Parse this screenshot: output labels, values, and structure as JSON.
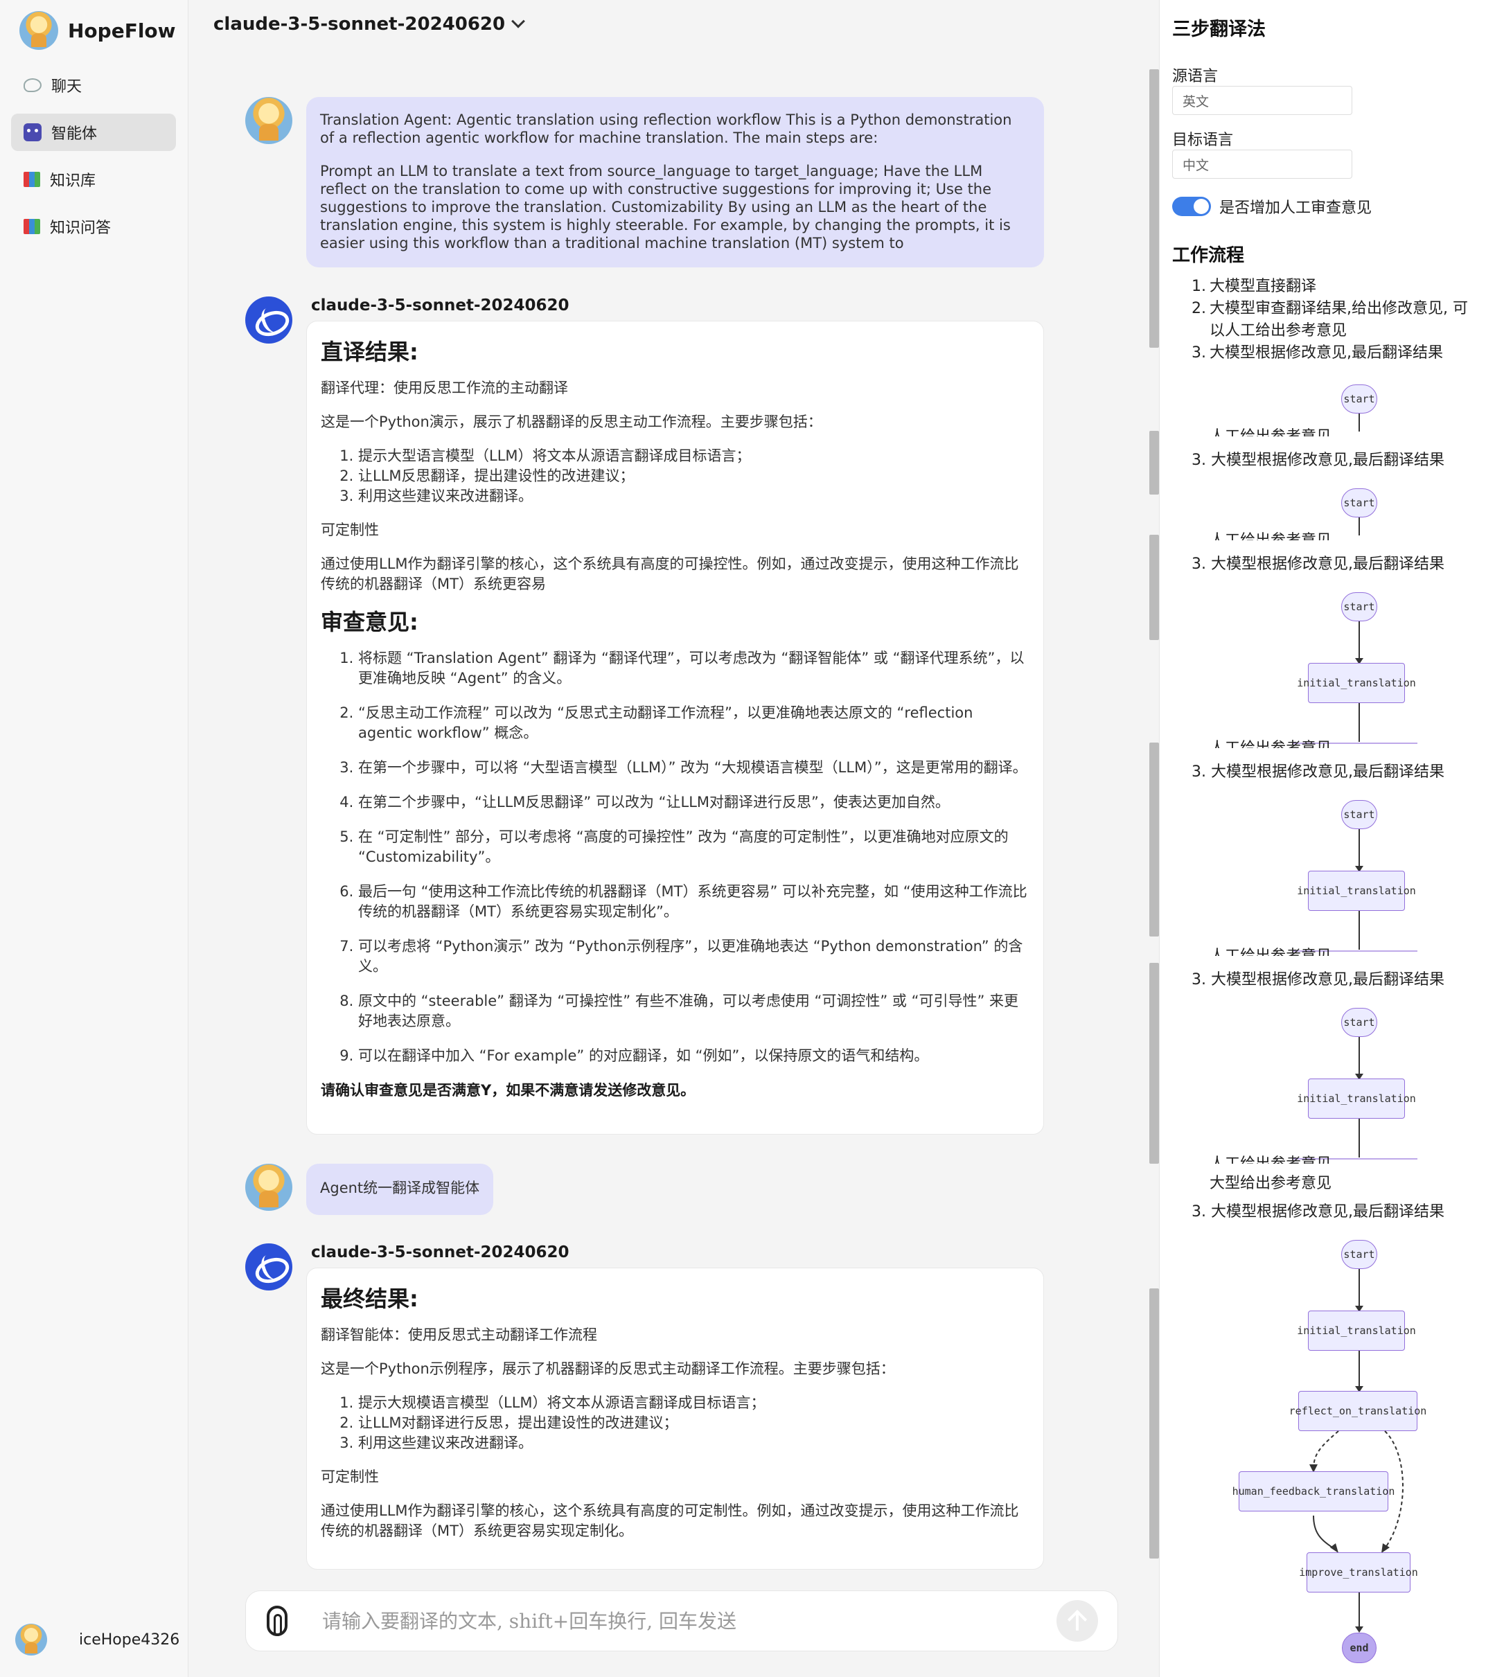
{
  "sidebar": {
    "brand": "HopeFlow",
    "items": [
      {
        "label": "聊天",
        "icon": "chat-bubble-icon"
      },
      {
        "label": "智能体",
        "icon": "robot-icon",
        "active": true
      },
      {
        "label": "知识库",
        "icon": "books-icon"
      },
      {
        "label": "知识问答",
        "icon": "books-icon"
      }
    ],
    "user": "iceHope4326"
  },
  "header": {
    "model": "claude-3-5-sonnet-20240620"
  },
  "messages": {
    "user1": {
      "p1": "Translation Agent: Agentic translation using reflection workflow This is a Python demonstration of a reflection agentic workflow for machine translation. The main steps are:",
      "p2": "Prompt an LLM to translate a text from source_language to target_language; Have the LLM reflect on the translation to come up with constructive suggestions for improving it; Use the suggestions to improve the translation. Customizability By using an LLM as the heart of the translation engine, this system is highly steerable. For example, by changing the prompts, it is easier using this workflow than a traditional machine translation (MT) system to"
    },
    "bot1": {
      "name": "claude-3-5-sonnet-20240620",
      "h1": "直译结果:",
      "p1": "翻译代理：使用反思工作流的主动翻译",
      "p2": "这是一个Python演示，展示了机器翻译的反思主动工作流程。主要步骤包括：",
      "steps": [
        "提示大型语言模型（LLM）将文本从源语言翻译成目标语言；",
        "让LLM反思翻译，提出建设性的改进建议；",
        "利用这些建议来改进翻译。"
      ],
      "p3": "可定制性",
      "p4": "通过使用LLM作为翻译引擎的核心，这个系统具有高度的可操控性。例如，通过改变提示，使用这种工作流比传统的机器翻译（MT）系统更容易",
      "h2": "审查意见:",
      "reviews": [
        "将标题 “Translation Agent” 翻译为 “翻译代理”，可以考虑改为 “翻译智能体” 或 “翻译代理系统”，以更准确地反映 “Agent” 的含义。",
        "“反思主动工作流程” 可以改为 “反思式主动翻译工作流程”，以更准确地表达原文的 “reflection agentic workflow” 概念。",
        "在第一个步骤中，可以将 “大型语言模型（LLM）” 改为 “大规模语言模型（LLM）”，这是更常用的翻译。",
        "在第二个步骤中，“让LLM反思翻译” 可以改为 “让LLM对翻译进行反思”，使表达更加自然。",
        "在 “可定制性” 部分，可以考虑将 “高度的可操控性” 改为 “高度的可定制性”，以更准确地对应原文的 “Customizability”。",
        "最后一句 “使用这种工作流比传统的机器翻译（MT）系统更容易” 可以补充完整，如 “使用这种工作流比传统的机器翻译（MT）系统更容易实现定制化”。",
        "可以考虑将 “Python演示” 改为 “Python示例程序”，以更准确地表达 “Python demonstration” 的含义。",
        "原文中的 “steerable” 翻译为 “可操控性” 有些不准确，可以考虑使用 “可调控性” 或 “可引导性” 来更好地表达原意。",
        "可以在翻译中加入 “For example” 的对应翻译，如 “例如”，以保持原文的语气和结构。"
      ],
      "confirm": "请确认审查意见是否满意Y，如果不满意请发送修改意见。"
    },
    "user2": {
      "text": "Agent统一翻译成智能体"
    },
    "bot2": {
      "name": "claude-3-5-sonnet-20240620",
      "h1": "最终结果:",
      "p1": "翻译智能体：使用反思式主动翻译工作流程",
      "p2": "这是一个Python示例程序，展示了机器翻译的反思式主动翻译工作流程。主要步骤包括：",
      "steps": [
        "提示大规模语言模型（LLM）将文本从源语言翻译成目标语言；",
        "让LLM对翻译进行反思，提出建设性的改进建议；",
        "利用这些建议来改进翻译。"
      ],
      "p3": "可定制性",
      "p4": "通过使用LLM作为翻译引擎的核心，这个系统具有高度的可定制性。例如，通过改变提示，使用这种工作流比传统的机器翻译（MT）系统更容易实现定制化。"
    }
  },
  "input": {
    "placeholder": "请输入要翻译的文本, shift+回车换行, 回车发送"
  },
  "panel": {
    "title": "三步翻译法",
    "source_label": "源语言",
    "source_value": "英文",
    "target_label": "目标语言",
    "target_value": "中文",
    "toggle_label": "是否增加人工审查意见",
    "toggle_on": true,
    "workflow_title": "工作流程",
    "steps": [
      {
        "num": "1.",
        "text": "大模型直接翻译"
      },
      {
        "num": "2.",
        "text": "大模型审查翻译结果,给出修改意见, 可以人工给出参考意见"
      },
      {
        "num": "3.",
        "text": "大模型根据修改意见,最后翻译结果"
      }
    ],
    "ghost_text": "人工给出参考意见",
    "ghost_text2": "大型给出参考意见",
    "step3_text": "3. 大模型根据修改意见,最后翻译结果",
    "nodes": {
      "start": "start",
      "initial": "initial_translation",
      "reflect": "reflect_on_translation",
      "human": "human_feedback_translation",
      "improve": "improve_translation",
      "end": "end"
    },
    "accent_color": "#9370db",
    "node_fill": "#ececff"
  }
}
